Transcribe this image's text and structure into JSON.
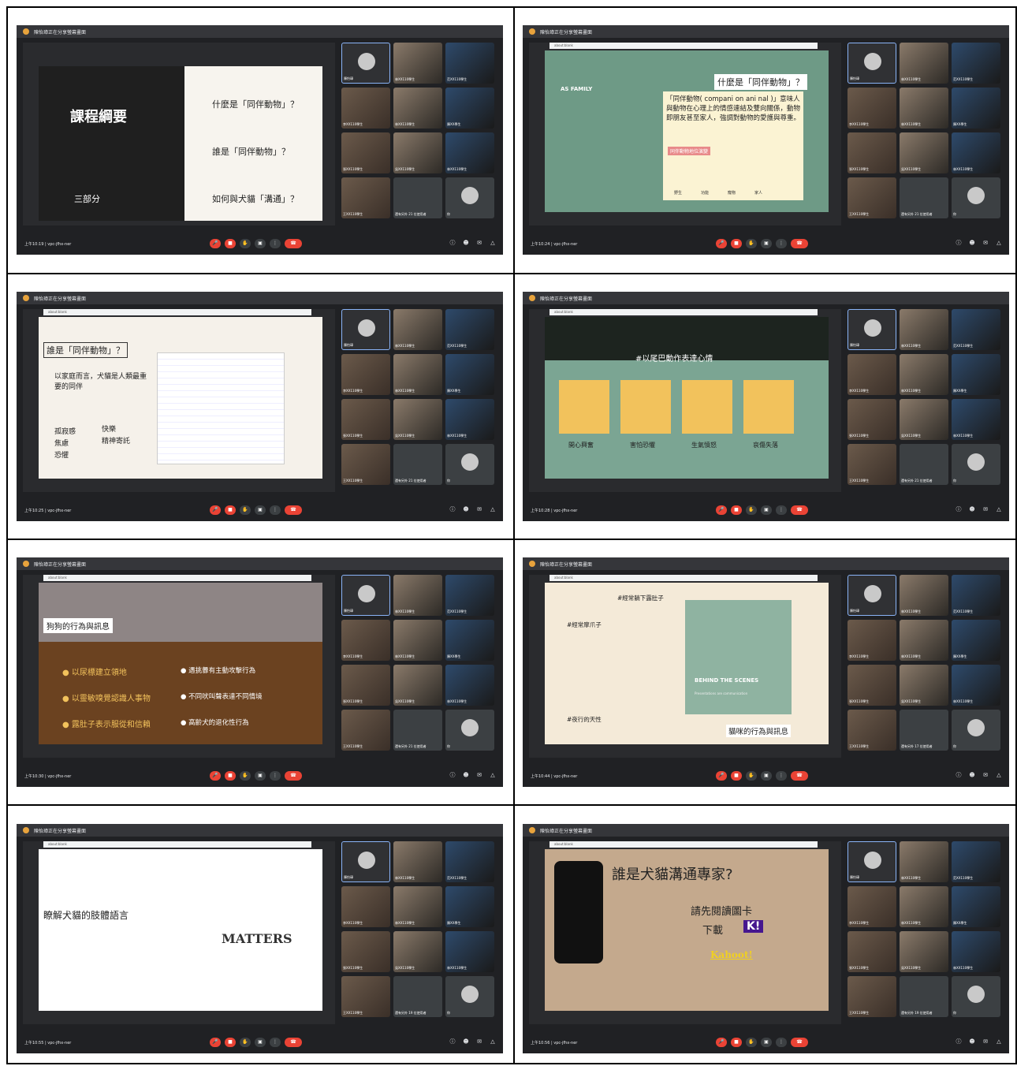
{
  "meeting": {
    "banner": "陳怡璋正在分享螢幕畫面",
    "code": "vpc-jfhx-ner",
    "url": "about:blank",
    "others_21": "還有另外 21 位使用者",
    "others_19": "還有另外 19 位使用者",
    "others_17": "還有另外 17 位使用者",
    "you": "你"
  },
  "panels": [
    {
      "time": "上午10:19",
      "slide_title": "課程綱要",
      "items": [
        "什麼是「同伴動物」？",
        "誰是「同伴動物」？",
        "如何與犬貓「溝通」？"
      ],
      "foot": "三部分"
    },
    {
      "time": "上午10:24",
      "slide_title": "什麼是「同伴動物」？",
      "tag": "AS FAMILY",
      "body": "「同伴動物( compani on ani nal )」意味人與動物在心理上的情感連結及雙向關係，動物即朋友甚至家人，強調對動物的愛護與尊重。",
      "sub": "同伴動物地位演變",
      "stages": [
        "野生",
        "功能",
        "寵物",
        "家人"
      ]
    },
    {
      "time": "上午10:25",
      "slide_title": "誰是「同伴動物」？",
      "body": "以家庭而言，犬貓是人類最重要的同伴",
      "left": [
        "孤寂感",
        "焦慮",
        "恐懼"
      ],
      "right": [
        "快樂",
        "精神寄託"
      ]
    },
    {
      "time": "上午10:28",
      "slide_title": "#以尾巴動作表達心情",
      "cards": [
        "開心興奮",
        "害怕恐懼",
        "生氣憤怒",
        "哀傷失落"
      ]
    },
    {
      "time": "上午10:30",
      "slide_title": "狗狗的行為與訊息",
      "bullets": [
        "以尿標建立領地",
        "遇挑釁有主動攻擊行為",
        "以靈敏嗅覺認識人事物",
        "不同吠叫聲表達不同情境",
        "露肚子表示服從和信賴",
        "高齡犬的退化性行為"
      ]
    },
    {
      "time": "上午10:44",
      "slide_title": "貓咪的行為與訊息",
      "tags": [
        "#經常躺下露肚子",
        "#經常摩爪子",
        "#夜行的天性"
      ],
      "scene": "BEHIND THE SCENES",
      "scene_sub": "Presentations are communication"
    },
    {
      "time": "上午10:55",
      "slide_title": "瞭解犬貓的肢體語言",
      "word": "MATTERS"
    },
    {
      "time": "上午10:56",
      "slide_title": "誰是犬貓溝通專家?",
      "line1": "請先閱讀圖卡",
      "line2": "下載",
      "k": "K!",
      "kahoot": "Kahoot!"
    }
  ],
  "tile_names": [
    "陳怡璋",
    "林XX110學生",
    "范XX110學生",
    "李XX110學生",
    "林XX110學生",
    "陳XX學生",
    "張XX110學生",
    "吳XX110學生",
    "林XX110學生",
    "王XX110學生"
  ]
}
